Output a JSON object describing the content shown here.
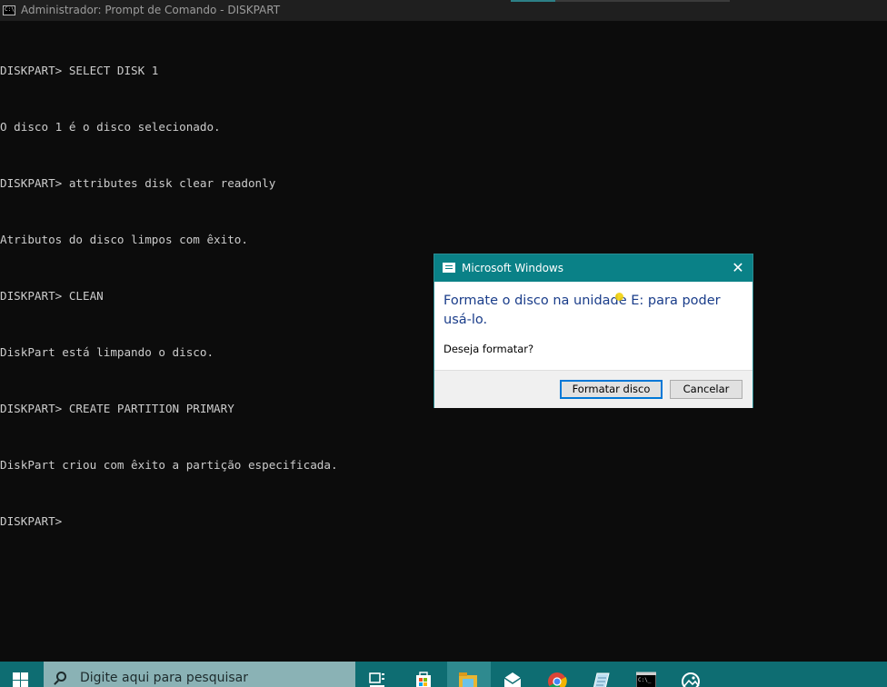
{
  "window": {
    "title": "Administrador: Prompt de Comando - DISKPART",
    "icon": "cmd-icon"
  },
  "console": {
    "lines": [
      "DISKPART> SELECT DISK 1",
      "O disco 1 é o disco selecionado.",
      "DISKPART> attributes disk clear readonly",
      "Atributos do disco limpos com êxito.",
      "DISKPART> CLEAN",
      "DiskPart está limpando o disco.",
      "DISKPART> CREATE PARTITION PRIMARY",
      "DiskPart criou com êxito a partição especificada.",
      "DISKPART>"
    ]
  },
  "dialog": {
    "title": "Microsoft Windows",
    "heading": "Formate o disco na unidade E: para poder usá-lo.",
    "question": "Deseja formatar?",
    "primary_button": "Formatar disco",
    "secondary_button": "Cancelar",
    "close_glyph": "✕"
  },
  "taskbar": {
    "search_placeholder": "Digite aqui para pesquisar",
    "icons": [
      "windows-start-icon",
      "task-view-icon",
      "store-icon",
      "file-explorer-icon",
      "mail-icon",
      "chrome-icon",
      "notepad-icon",
      "cmd-icon",
      "photos-icon"
    ]
  },
  "colors": {
    "console_bg": "#0c0c0c",
    "console_text": "#cccccc",
    "dialog_accent": "#0a8187",
    "dialog_heading": "#1a3d8a",
    "taskbar_bg": "#0e6d72",
    "button_focus": "#0078d7"
  }
}
